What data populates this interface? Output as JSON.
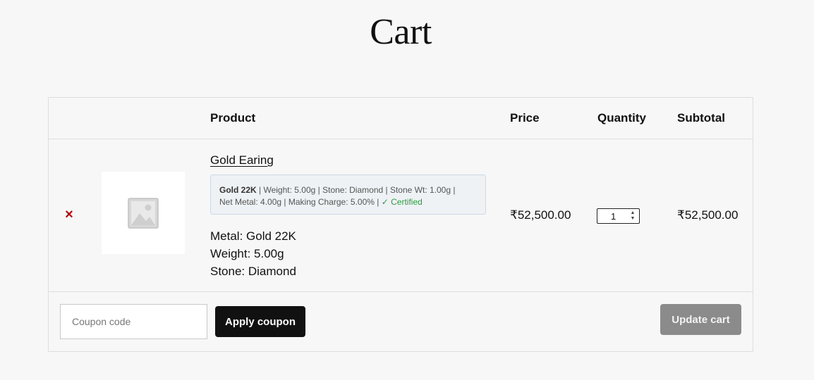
{
  "page": {
    "title": "Cart"
  },
  "table": {
    "headers": {
      "product": "Product",
      "price": "Price",
      "quantity": "Quantity",
      "subtotal": "Subtotal"
    },
    "items": [
      {
        "remove_icon": "close-icon",
        "remove_glyph": "×",
        "thumbnail_icon": "image-placeholder-icon",
        "name": "Gold Earing",
        "spec": {
          "purity": "Gold 22K",
          "sep1": " | ",
          "weight": "Weight: 5.00g",
          "sep2": " | ",
          "stone": "Stone: Diamond",
          "sep3": " | ",
          "stone_wt": "Stone Wt: 1.00g",
          "sep4": " | ",
          "net_metal": "Net Metal: 4.00g",
          "sep5": " | ",
          "making_charge": "Making Charge: 5.00%",
          "sep6": " | ",
          "certified": "✓ Certified"
        },
        "meta": [
          "Metal: Gold 22K",
          "Weight: 5.00g",
          "Stone: Diamond"
        ],
        "price": "₹52,500.00",
        "quantity": "1",
        "subtotal": "₹52,500.00"
      }
    ]
  },
  "actions": {
    "coupon_placeholder": "Coupon code",
    "apply_label": "Apply coupon",
    "update_label": "Update cart"
  },
  "colors": {
    "remove": "#b00000",
    "certified": "#2e9a3e",
    "apply_bg": "#111111",
    "update_bg": "#8b8b8b"
  }
}
